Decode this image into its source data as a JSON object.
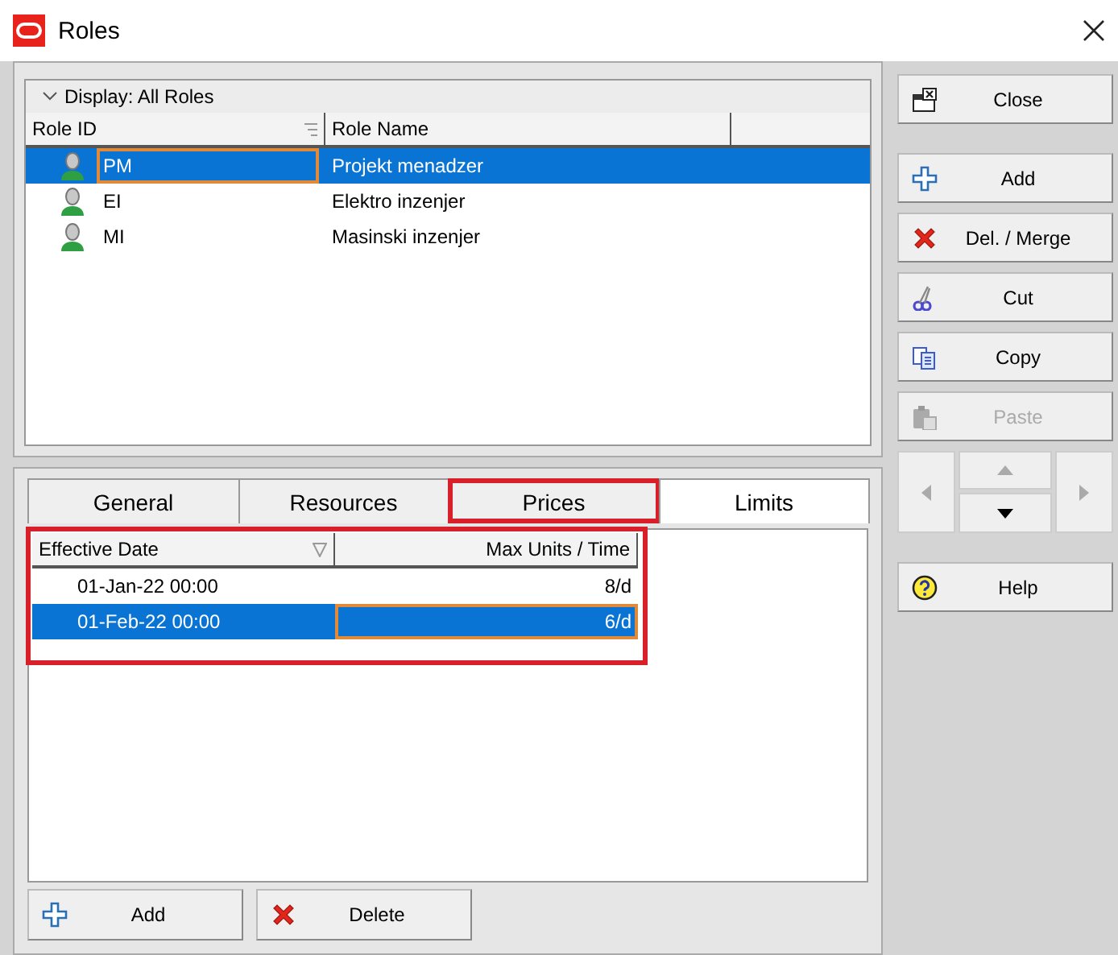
{
  "window": {
    "title": "Roles"
  },
  "roles": {
    "filter": "Display: All Roles",
    "columns": [
      "Role ID",
      "Role Name"
    ],
    "rows": [
      {
        "id": "PM",
        "name": "Projekt menadzer",
        "selected": true,
        "focused": true
      },
      {
        "id": "EI",
        "name": "Elektro inzenjer",
        "selected": false,
        "focused": false
      },
      {
        "id": "MI",
        "name": "Masinski inzenjer",
        "selected": false,
        "focused": false
      }
    ]
  },
  "tabs": [
    {
      "label": "General",
      "selected": false,
      "highlighted": false
    },
    {
      "label": "Resources",
      "selected": false,
      "highlighted": false
    },
    {
      "label": "Prices",
      "selected": false,
      "highlighted": true
    },
    {
      "label": "Limits",
      "selected": true,
      "highlighted": false
    }
  ],
  "limits": {
    "highlighted": true,
    "columns": [
      "Effective Date",
      "Max Units / Time"
    ],
    "rows": [
      {
        "date": "01-Jan-22 00:00",
        "units": "8/d",
        "selected": false,
        "focused": false
      },
      {
        "date": "01-Feb-22 00:00",
        "units": "6/d",
        "selected": true,
        "focused": true
      }
    ],
    "buttons": [
      {
        "kind": "add",
        "label": "Add"
      },
      {
        "kind": "delete",
        "label": "Delete"
      }
    ]
  },
  "side_buttons": [
    {
      "kind": "close",
      "label": "Close",
      "disabled": false
    },
    {
      "kind": "add",
      "label": "Add",
      "disabled": false
    },
    {
      "kind": "delete",
      "label": "Del. / Merge",
      "disabled": false
    },
    {
      "kind": "cut",
      "label": "Cut",
      "disabled": false
    },
    {
      "kind": "copy",
      "label": "Copy",
      "disabled": false
    },
    {
      "kind": "paste",
      "label": "Paste",
      "disabled": true
    }
  ],
  "nav": [
    {
      "kind": "left",
      "disabled": true
    },
    {
      "kind": "up",
      "disabled": true
    },
    {
      "kind": "down",
      "disabled": false
    },
    {
      "kind": "right",
      "disabled": true
    }
  ],
  "help": {
    "label": "Help"
  }
}
